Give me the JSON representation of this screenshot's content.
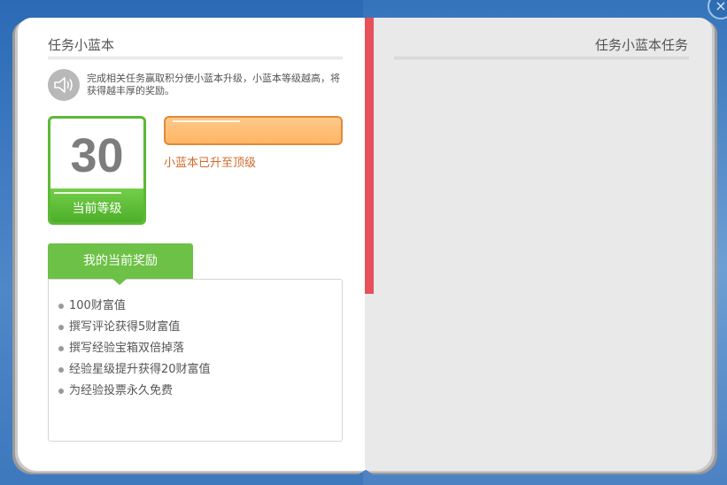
{
  "window": {
    "close_glyph": "×"
  },
  "left_page": {
    "title": "任务小蓝本",
    "description": "完成相关任务赢取积分使小蓝本升级，小蓝本等级越高，将获得越丰厚的奖励。",
    "speaker_icon": "speaker-icon",
    "level": {
      "value": "30",
      "label": "当前等级"
    },
    "progress": {
      "fraction": 1.0,
      "note": "小蓝本已升至顶级"
    },
    "rewards": {
      "tab_label": "我的当前奖励",
      "items": [
        "100财富值",
        "撰写评论获得5财富值",
        "撰写经验宝箱双倍掉落",
        "经验星级提升获得20财富值",
        "为经验投票永久免费"
      ]
    }
  },
  "right_page": {
    "title": "任务小蓝本任务"
  },
  "colors": {
    "accent_green": "#6cc146",
    "progress_orange": "#ffb565",
    "ribbon_red": "#e8505a",
    "background_blue": "#2c6ab6"
  }
}
